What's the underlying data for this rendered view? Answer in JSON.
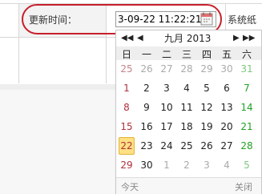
{
  "form": {
    "field_label": "更新时间：",
    "date_value": "3-09-22 11:22:21",
    "next_label": "系统纸"
  },
  "calendar": {
    "nav": {
      "prev_year": "◀◀",
      "prev_month": "◀",
      "next_month": "▶",
      "next_year": "▶▶"
    },
    "month_title": "九月 2013",
    "weekdays": [
      "日",
      "一",
      "二",
      "三",
      "四",
      "五",
      "六"
    ],
    "weeks": [
      [
        "25",
        "26",
        "27",
        "28",
        "29",
        "30",
        "31"
      ],
      [
        "1",
        "2",
        "3",
        "4",
        "5",
        "6",
        "7"
      ],
      [
        "8",
        "9",
        "10",
        "11",
        "12",
        "13",
        "14"
      ],
      [
        "15",
        "16",
        "17",
        "18",
        "19",
        "20",
        "21"
      ],
      [
        "22",
        "23",
        "24",
        "25",
        "26",
        "27",
        "28"
      ],
      [
        "29",
        "30",
        "1",
        "2",
        "3",
        "4",
        "5"
      ]
    ],
    "today_button": "今天",
    "close_button": "关闭"
  },
  "colors": {
    "highlight_oval": "#c7202c",
    "sunday": "#b0303a",
    "saturday": "#22a022",
    "today_bg": "#ffe082"
  }
}
